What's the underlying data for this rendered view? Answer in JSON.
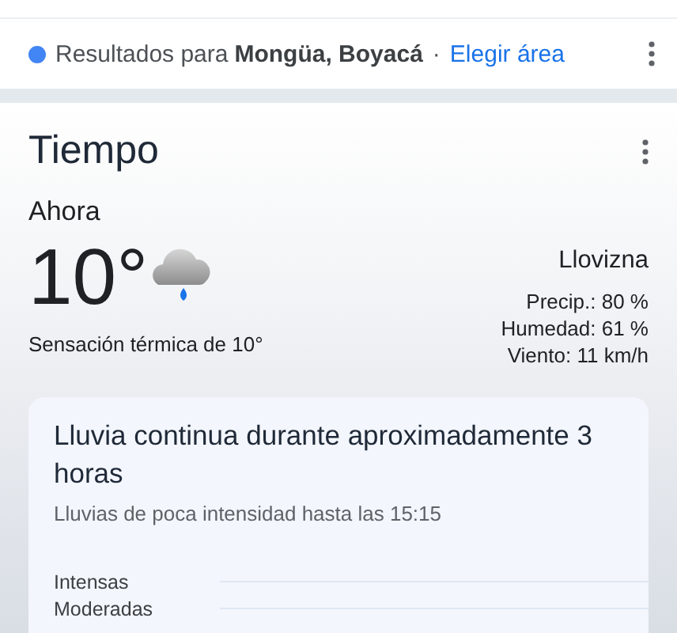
{
  "location_bar": {
    "prefix": "Resultados para",
    "place": "Mongüa, Boyacá",
    "separator": "·",
    "link": "Elegir área"
  },
  "weather": {
    "title": "Tiempo",
    "now_label": "Ahora",
    "temperature": "10°",
    "feels_like": "Sensación térmica de 10°",
    "condition": "Llovizna",
    "details": [
      "Precip.: 80 %",
      "Humedad: 61 %",
      "Viento: 11 km/h"
    ],
    "forecast_card": {
      "headline": "Lluvia continua durante aproximadamente 3 horas",
      "subtitle": "Lluvias de poca intensidad hasta las 15:15",
      "intensity_levels": [
        "Intensas",
        "Moderadas"
      ]
    }
  }
}
